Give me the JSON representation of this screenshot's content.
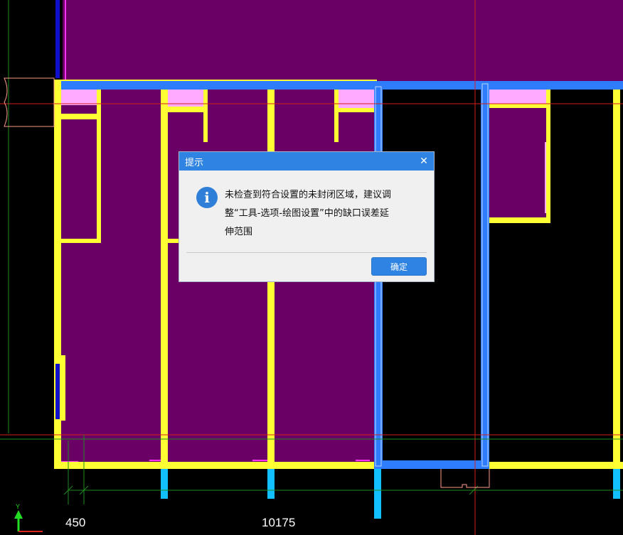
{
  "dimensions": {
    "left_value": "450",
    "mid_value": "10175"
  },
  "dialog": {
    "title": "提示",
    "close_icon": "close-icon",
    "info_icon": "info-icon",
    "info_glyph": "i",
    "message": "未检查到符合设置的未封闭区域，建议调\n整“工具-选项-绘图设置”中的缺口误差延\n伸范围",
    "confirm_label": "确定"
  },
  "colors": {
    "room_fill": "#6a0066",
    "wall": "#ffff33",
    "selected_wall": "#2e7dff",
    "pink": "#ffaaff",
    "column": "#12c0ff",
    "guide_red": "#d21e1e",
    "guide_green": "#1e8c1e"
  }
}
